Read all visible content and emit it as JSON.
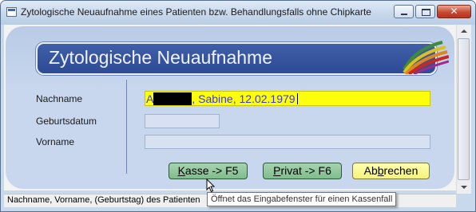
{
  "window": {
    "title": "Zytologische Neuaufnahme eines Patienten bzw. Behandlungsfalls ohne Chipkarte",
    "close_glyph": "✕"
  },
  "header": {
    "title": "Zytologische Neuaufnahme"
  },
  "form": {
    "nachname_label": "Nachname",
    "geburtsdatum_label": "Geburtsdatum",
    "vorname_label": "Vorname",
    "nachname_prefix": "A",
    "nachname_suffix": ", Sabine, 12.02.1979",
    "geburtsdatum_value": "",
    "vorname_value": ""
  },
  "buttons": {
    "kasse_hotkey": "K",
    "kasse_rest": "asse -> F5",
    "privat_hotkey": "P",
    "privat_rest": "rivat -> F6",
    "abbrechen_pre": "Ab",
    "abbrechen_hotkey": "b",
    "abbrechen_post": "rechen"
  },
  "status": {
    "text": "Nachname, Vorname, (Geburtstag) des Patienten"
  },
  "tooltip": {
    "text": "Öffnet das Eingabefenster für einen Kassenfall"
  },
  "icons": {
    "window_icon": "app-window-icon",
    "logo": "rainbow-swoosh-logo",
    "cursor": "mouse-pointer-icon"
  },
  "colors": {
    "header_bg": "#2e4b95",
    "name_field_bg": "#ffff0a",
    "name_text": "#3b3bd6",
    "button_green": "#7fbd8c",
    "button_yellow": "#f6f27a"
  }
}
